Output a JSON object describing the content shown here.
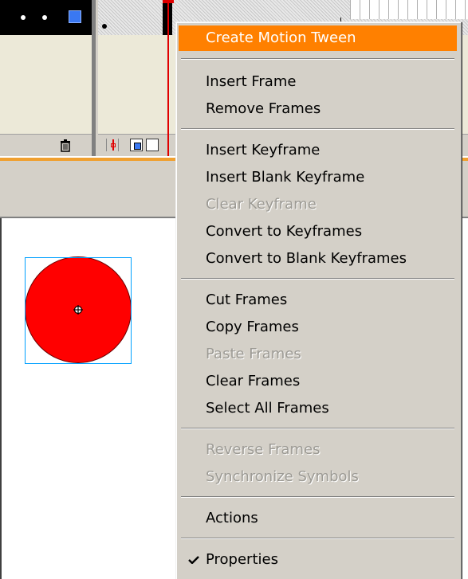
{
  "timeline": {
    "layer_outline_color": "#3a78f2",
    "playhead_color": "#e00000"
  },
  "stage": {
    "circle_fill": "#ff0000",
    "selection_color": "#00a0ff"
  },
  "context_menu": {
    "highlight_color": "#ff8000",
    "items": [
      {
        "label": "Create Motion Tween",
        "enabled": true,
        "highlighted": true
      },
      {
        "label": "Insert Frame",
        "enabled": true
      },
      {
        "label": "Remove Frames",
        "enabled": true
      },
      {
        "label": "Insert Keyframe",
        "enabled": true
      },
      {
        "label": "Insert Blank Keyframe",
        "enabled": true
      },
      {
        "label": "Clear Keyframe",
        "enabled": false
      },
      {
        "label": "Convert to Keyframes",
        "enabled": true
      },
      {
        "label": "Convert to Blank Keyframes",
        "enabled": true
      },
      {
        "label": "Cut Frames",
        "enabled": true
      },
      {
        "label": "Copy Frames",
        "enabled": true
      },
      {
        "label": "Paste Frames",
        "enabled": false
      },
      {
        "label": "Clear Frames",
        "enabled": true
      },
      {
        "label": "Select All Frames",
        "enabled": true
      },
      {
        "label": "Reverse Frames",
        "enabled": false
      },
      {
        "label": "Synchronize Symbols",
        "enabled": false
      },
      {
        "label": "Actions",
        "enabled": true
      },
      {
        "label": "Properties",
        "enabled": true,
        "checked": true
      }
    ]
  }
}
